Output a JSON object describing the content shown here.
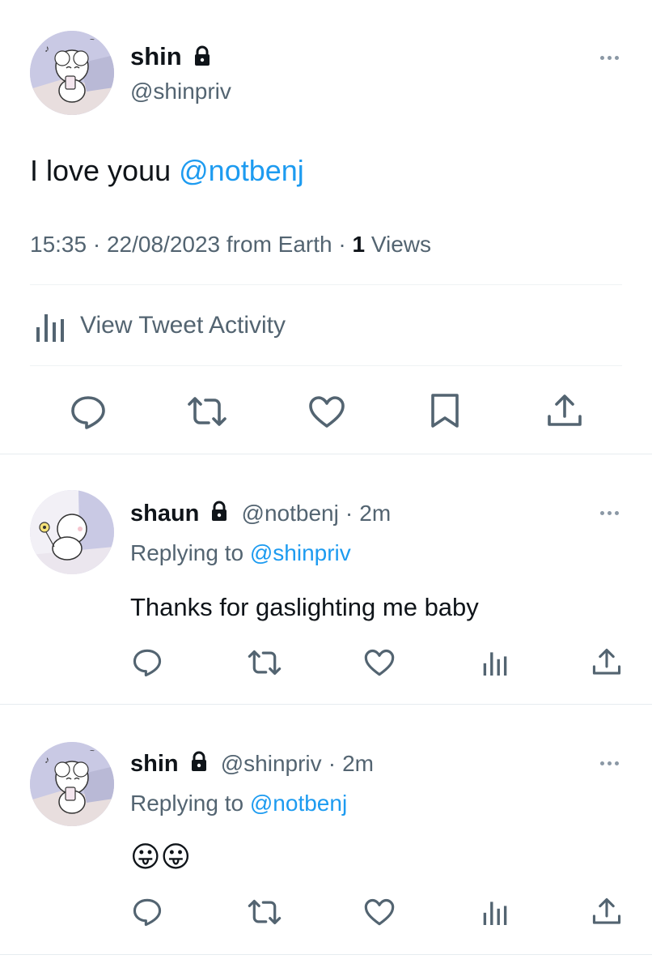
{
  "main_tweet": {
    "display_name": "shin",
    "handle": "@shinpriv",
    "text_prefix": "I love youu ",
    "text_mention": "@notbenj",
    "time": "15:35",
    "sep1": "·",
    "date": "22/08/2023",
    "source": "from Earth",
    "sep2": "·",
    "views_count": "1",
    "views_label": "Views",
    "activity_label": "View Tweet Activity"
  },
  "replies": [
    {
      "display_name": "shaun",
      "handle": "@notbenj",
      "sep": "·",
      "time": "2m",
      "replying_label": "Replying to",
      "replying_to": "@shinpriv",
      "text": "Thanks for gaslighting me baby"
    },
    {
      "display_name": "shin",
      "handle": "@shinpriv",
      "sep": "·",
      "time": "2m",
      "replying_label": "Replying to",
      "replying_to": "@notbenj",
      "text": "😛😛"
    }
  ],
  "icons": {
    "lock": "lock-icon",
    "more": "more-horizontal-icon",
    "reply": "reply-icon",
    "retweet": "retweet-icon",
    "like": "heart-icon",
    "bookmark": "bookmark-icon",
    "share": "share-icon",
    "analytics": "analytics-icon"
  },
  "colors": {
    "text": "#0f1419",
    "muted": "#536471",
    "link": "#1d9bf0",
    "divider": "#eff3f4"
  }
}
